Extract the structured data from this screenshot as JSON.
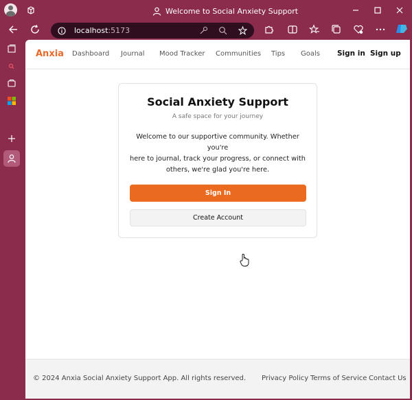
{
  "browser": {
    "window_title": "Welcome to Social Anxiety Support",
    "url_host": "localhost",
    "url_port": ":5173"
  },
  "app": {
    "brand": "Anxia",
    "nav": [
      "Dashboard",
      "Journal",
      "Mood Tracker",
      "Communities",
      "Tips",
      "Goals"
    ],
    "sign_in": "Sign in",
    "sign_up": "Sign up"
  },
  "card": {
    "title": "Social Anxiety Support",
    "subtitle": "A safe space for your journey",
    "body_lines": [
      "Welcome to our supportive community. Whether you're",
      "here to journal, track your progress, or connect with",
      "others, we're glad you're here."
    ],
    "primary_button": "Sign In",
    "secondary_button": "Create Account"
  },
  "footer": {
    "copyright": "© 2024 Anxia Social Anxiety Support App. All rights reserved.",
    "links": [
      "Privacy Policy",
      "Terms of Service",
      "Contact Us"
    ]
  },
  "colors": {
    "browser_frame": "#8b2c4c",
    "brand_accent": "#e8692b",
    "primary_button": "#ea6a1f"
  }
}
